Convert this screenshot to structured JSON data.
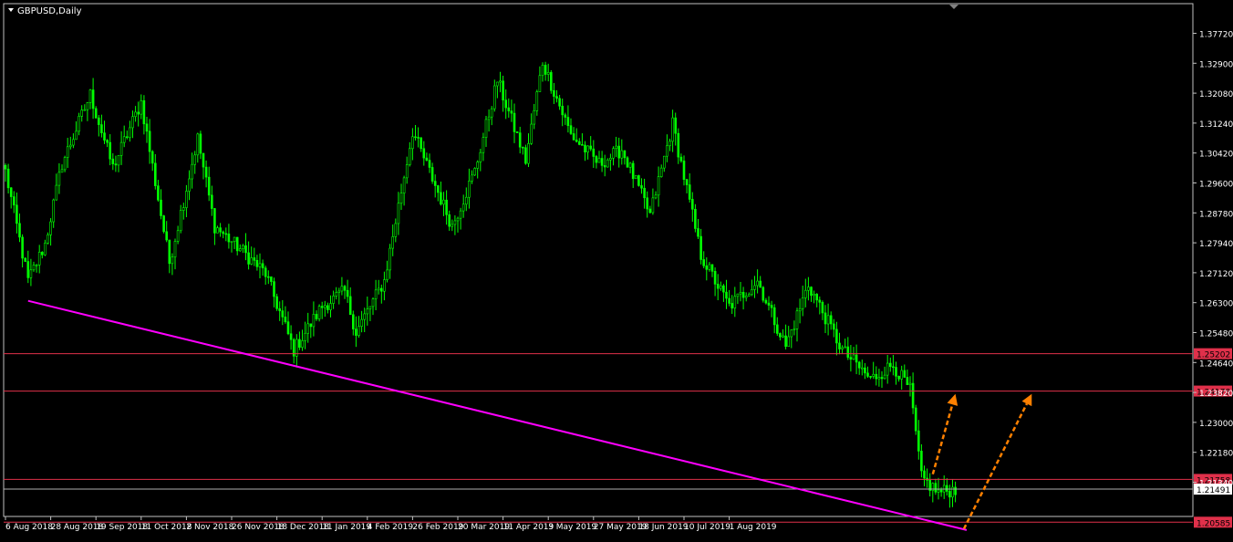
{
  "header": {
    "title": "GBPUSD,Daily"
  },
  "colors": {
    "background": "#000000",
    "frame": "#c0c0c0",
    "candle": "#00ff00",
    "support_line": "#ff00ff",
    "level_line": "#e0304a",
    "level_tag": "#e0304a",
    "current_line": "#b0b0b0",
    "arrow": "#ff8000",
    "text": "#ffffff"
  },
  "chart_data": {
    "type": "candlestick",
    "symbol": "GBPUSD",
    "timeframe": "Daily",
    "ylim": [
      1.2037,
      1.3398
    ],
    "y_ticks": [
      "1.37720",
      "1.32900",
      "1.32080",
      "1.31240",
      "1.30420",
      "1.29600",
      "1.28780",
      "1.27940",
      "1.27120",
      "1.26300",
      "1.25480",
      "1.24640",
      "1.23820",
      "1.23000",
      "1.22180",
      "1.21340"
    ],
    "x_ticks": [
      "6 Aug 2018",
      "28 Aug 2018",
      "19 Sep 2018",
      "11 Oct 2018",
      "2 Nov 2018",
      "26 Nov 2018",
      "18 Dec 2018",
      "11 Jan 2019",
      "4 Feb 2019",
      "26 Feb 2019",
      "20 Mar 2019",
      "11 Apr 2019",
      "3 May 2019",
      "27 May 2019",
      "18 Jun 2019",
      "10 Jul 2019",
      "1 Aug 2019"
    ],
    "anchors": [
      [
        0,
        1.302
      ],
      [
        8,
        1.272
      ],
      [
        14,
        1.282
      ],
      [
        20,
        1.304
      ],
      [
        30,
        1.323
      ],
      [
        38,
        1.303
      ],
      [
        48,
        1.321
      ],
      [
        58,
        1.277
      ],
      [
        68,
        1.311
      ],
      [
        74,
        1.287
      ],
      [
        84,
        1.28
      ],
      [
        92,
        1.274
      ],
      [
        102,
        1.253
      ],
      [
        112,
        1.265
      ],
      [
        120,
        1.269
      ],
      [
        124,
        1.258
      ],
      [
        134,
        1.272
      ],
      [
        144,
        1.313
      ],
      [
        158,
        1.287
      ],
      [
        166,
        1.302
      ],
      [
        174,
        1.327
      ],
      [
        184,
        1.305
      ],
      [
        190,
        1.332
      ],
      [
        200,
        1.312
      ],
      [
        210,
        1.304
      ],
      [
        218,
        1.308
      ],
      [
        228,
        1.29
      ],
      [
        236,
        1.315
      ],
      [
        246,
        1.279
      ],
      [
        256,
        1.265
      ],
      [
        266,
        1.272
      ],
      [
        276,
        1.254
      ],
      [
        284,
        1.271
      ],
      [
        296,
        1.253
      ],
      [
        306,
        1.245
      ],
      [
        314,
        1.249
      ],
      [
        320,
        1.242
      ],
      [
        324,
        1.218
      ],
      [
        330,
        1.214
      ],
      [
        336,
        1.2149
      ]
    ],
    "levels": [
      {
        "value": 1.25202,
        "label": "1.25202"
      },
      {
        "value": 1.24178,
        "label": "1.24178"
      },
      {
        "value": 1.21758,
        "label": "1.21758"
      },
      {
        "value": 1.20585,
        "label": "1.20585"
      }
    ],
    "current_price": {
      "value": 1.21491,
      "label": "1.21491"
    },
    "support_line": {
      "from": [
        8,
        1.2665
      ],
      "to": [
        340,
        1.2037
      ]
    },
    "arrows": [
      {
        "from": [
          328,
          1.219
        ],
        "to": [
          336,
          1.241
        ]
      },
      {
        "from": [
          339,
          1.204
        ],
        "to": [
          363,
          1.241
        ]
      }
    ]
  }
}
